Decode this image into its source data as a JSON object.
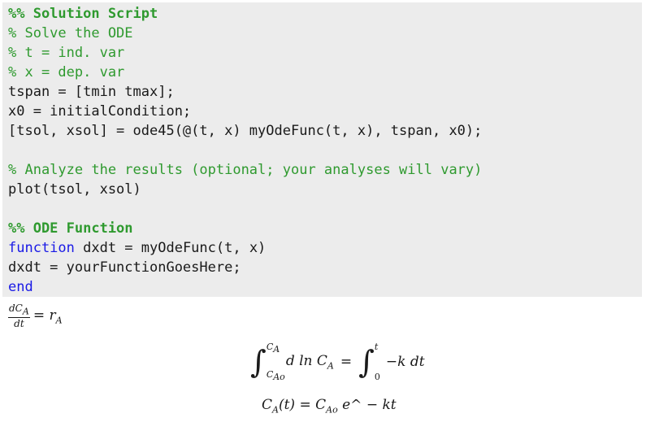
{
  "code": {
    "lines": [
      {
        "text": "%% Solution Script",
        "style": "section"
      },
      {
        "text": "% Solve the ODE",
        "style": "comment"
      },
      {
        "text": "% t = ind. var",
        "style": "comment"
      },
      {
        "text": "% x = dep. var",
        "style": "comment"
      },
      {
        "text": "tspan = [tmin tmax];",
        "style": "code"
      },
      {
        "text": "x0 = initialCondition;",
        "style": "code"
      },
      {
        "text": "[tsol, xsol] = ode45(@(t, x) myOdeFunc(t, x), tspan, x0);",
        "style": "code"
      },
      {
        "text": "",
        "style": "code"
      },
      {
        "text": "% Analyze the results (optional; your analyses will vary)",
        "style": "comment"
      },
      {
        "text": "plot(tsol, xsol)",
        "style": "code"
      },
      {
        "text": "",
        "style": "code"
      },
      {
        "text": "%% ODE Function",
        "style": "section"
      },
      {
        "text": "function",
        "style": "keyword",
        "rest": " dxdt = myOdeFunc(t, x)"
      },
      {
        "text": "dxdt = yourFunctionGoesHere;",
        "style": "code"
      },
      {
        "text": "end",
        "style": "keyword"
      }
    ]
  },
  "equations": {
    "rate": {
      "num": "dC",
      "num_sub": "A",
      "den": "dt",
      "rhs": "= r",
      "rhs_sub": "A"
    },
    "integral": {
      "upper1": "C",
      "upper1_sub": "A",
      "lower1": "C",
      "lower1_sub": "Ao",
      "integrand1": "d ln C",
      "integrand1_sub": "A",
      "eq": "=",
      "upper2": "t",
      "lower2": "0",
      "integrand2": "−k dt"
    },
    "solution": {
      "lhs": "C",
      "lhs_sub": "A",
      "lhs_arg": "(t) = C",
      "rhs_sub": "Ao",
      "rhs": " e^ − kt"
    }
  }
}
